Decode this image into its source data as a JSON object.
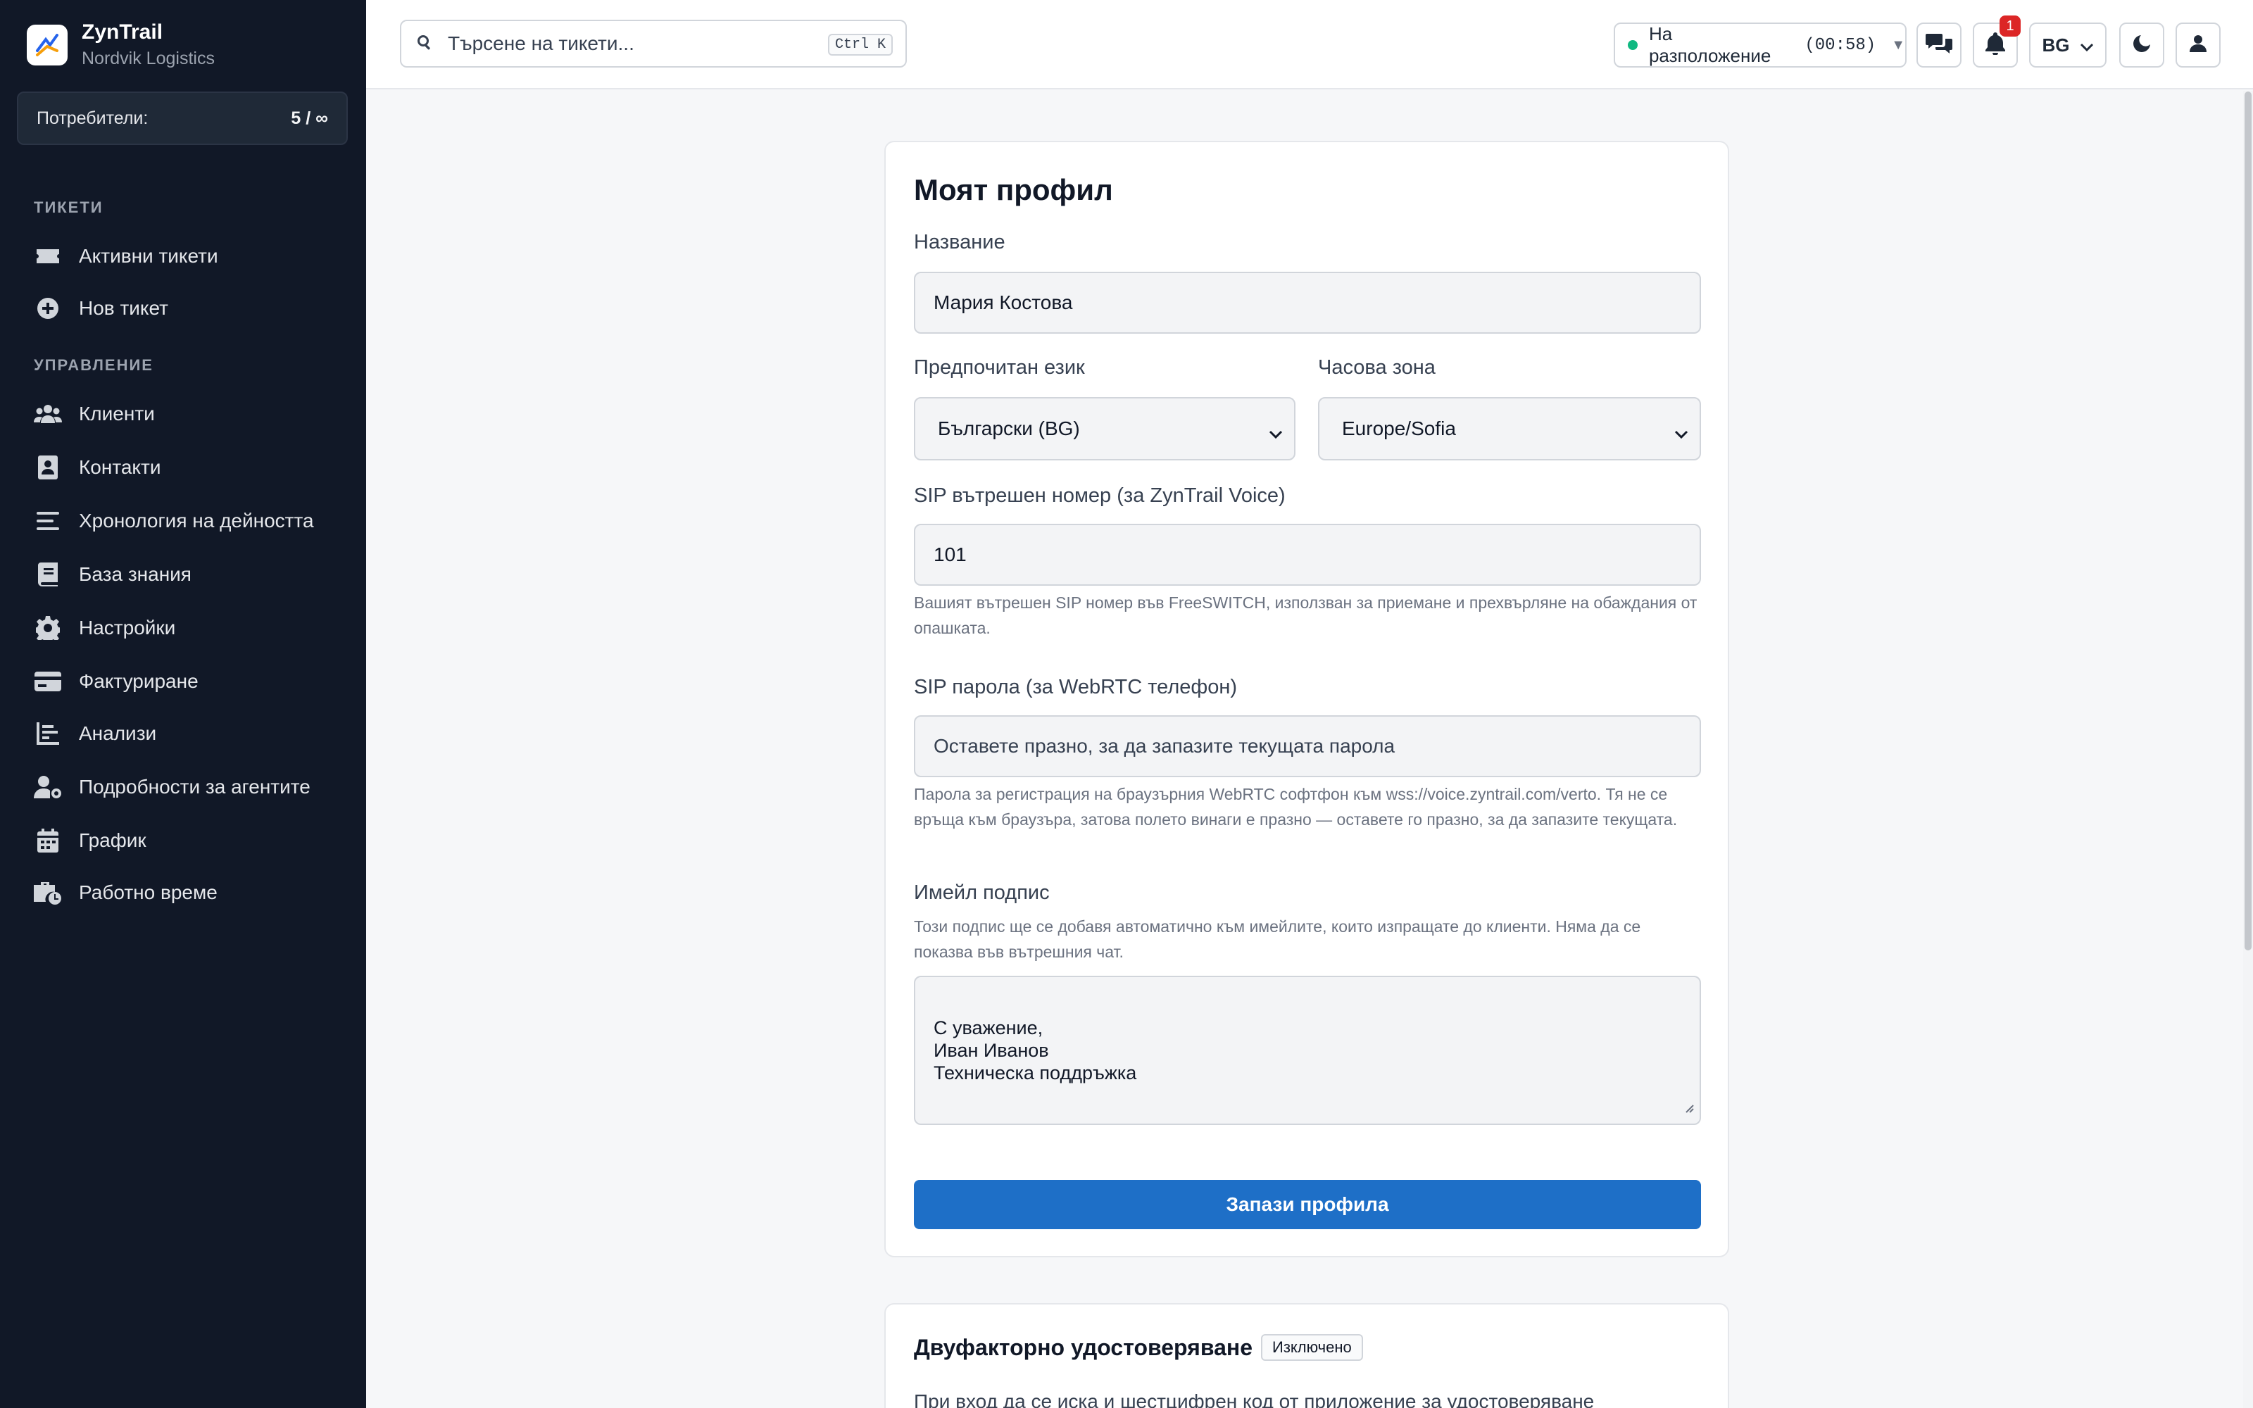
{
  "brand": {
    "name": "ZynTrail",
    "org": "Nordvik Logistics"
  },
  "users": {
    "label": "Потребители:",
    "count": "5 / ∞"
  },
  "nav": {
    "section_tickets": "ТИКЕТИ",
    "section_management": "УПРАВЛЕНИЕ",
    "items": [
      {
        "label": "Активни тикети",
        "icon": "ticket-icon"
      },
      {
        "label": "Нов тикет",
        "icon": "plus-circle-icon"
      },
      {
        "label": "Клиенти",
        "icon": "users-icon"
      },
      {
        "label": "Контакти",
        "icon": "contact-card-icon"
      },
      {
        "label": "Хронология на дейността",
        "icon": "lines-icon"
      },
      {
        "label": "База знания",
        "icon": "book-icon"
      },
      {
        "label": "Настройки",
        "icon": "gear-icon"
      },
      {
        "label": "Фактуриране",
        "icon": "credit-card-icon"
      },
      {
        "label": "Анализи",
        "icon": "chart-icon"
      },
      {
        "label": "Подробности за агентите",
        "icon": "user-cog-icon"
      },
      {
        "label": "График",
        "icon": "calendar-icon"
      },
      {
        "label": "Работно време",
        "icon": "briefcase-clock-icon"
      }
    ]
  },
  "topbar": {
    "search_placeholder": "Търсене на тикети...",
    "search_shortcut": "Ctrl K",
    "status_label": "На разположение",
    "status_time": "(00:58)",
    "notifications_count": "1",
    "language": "BG"
  },
  "profile": {
    "title": "Моят профил",
    "name_label": "Название",
    "name_value": "Мария Костова",
    "language_label": "Предпочитан език",
    "language_value": "Български (BG)",
    "timezone_label": "Часова зона",
    "timezone_value": "Europe/Sofia",
    "sip_ext_label": "SIP вътрешен номер (за ZynTrail Voice)",
    "sip_ext_value": "101",
    "sip_ext_help": "Вашият вътрешен SIP номер във FreeSWITCH, използван за приемане и прехвърляне на обаждания от опашката.",
    "sip_pass_label": "SIP парола (за WebRTC телефон)",
    "sip_pass_placeholder": "Оставете празно, за да запазите текущата парола",
    "sip_pass_help": "Парола за регистрация на браузърния WebRTC софтфон към wss://voice.zyntrail.com/verto. Тя не се връща към браузъра, затова полето винаги е празно — оставете го празно, за да запазите текущата.",
    "signature_label": "Имейл подпис",
    "signature_help": "Този подпис ще се добавя автоматично към имейлите, които изпращате до клиенти. Няма да се показва във вътрешния чат.",
    "signature_value": "С уважение,\nИван Иванов\nТехническа поддръжка",
    "save_label": "Запази профила"
  },
  "tfa": {
    "title": "Двуфакторно удостоверяване",
    "status": "Изключено",
    "text": "При вход да се иска и шестцифрен код от приложение за удостоверяване"
  }
}
